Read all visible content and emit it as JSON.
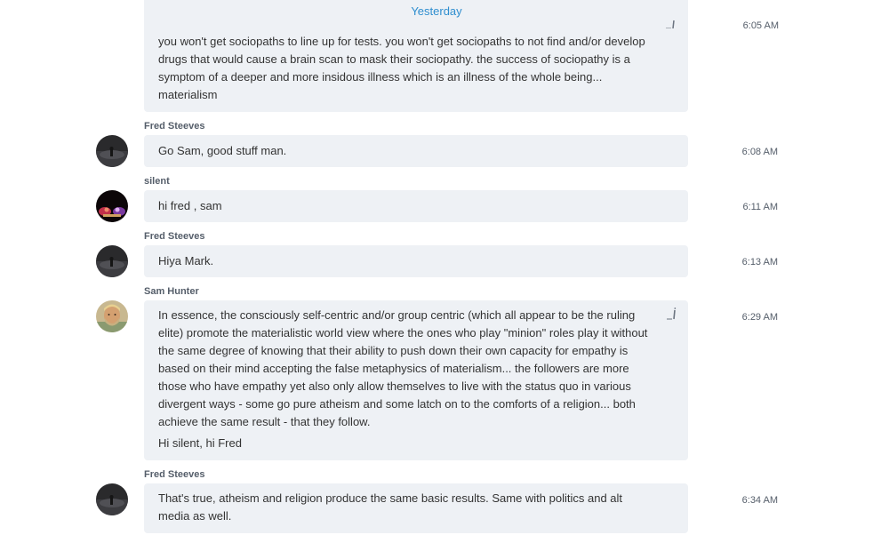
{
  "day_separator": "Yesterday",
  "messages": [
    {
      "sender": "",
      "time": "6:05 AM",
      "paragraphs": [
        "you won't get sociopaths to line up for tests.  you won't get sociopaths to not find and/or develop drugs that would cause a brain scan to mask their sociopathy.  the success of sociopathy is a symptom of a deeper and more insidous illness which is an illness of the whole being... materialism"
      ]
    },
    {
      "sender": "Fred Steeves",
      "time": "6:08 AM",
      "paragraphs": [
        "Go Sam, good stuff man."
      ]
    },
    {
      "sender": "silent",
      "time": "6:11 AM",
      "paragraphs": [
        "hi fred , sam"
      ]
    },
    {
      "sender": "Fred Steeves",
      "time": "6:13 AM",
      "paragraphs": [
        "Hiya Mark."
      ]
    },
    {
      "sender": "Sam Hunter",
      "time": "6:29 AM",
      "paragraphs": [
        "In essence, the consciously self-centric and/or group centric (which all appear to be the ruling elite) promote the materialistic world view where the ones who play \"minion\" roles play it without the same degree of knowing that their ability to push down their own capacity for empathy is based on their mind accepting the false metaphysics of materialism...   the followers are more those who have empathy yet also only allow themselves to live with the status quo in various divergent ways - some go pure atheism and some latch on to the comforts of a religion... both achieve the same result - that they follow.",
        "Hi silent, hi Fred"
      ]
    },
    {
      "sender": "Fred Steeves",
      "time": "6:34 AM",
      "paragraphs": [
        "That's true, atheism and religion produce the same basic results. Same with politics and alt media as well."
      ]
    }
  ],
  "icons": {
    "edited": "edit-pencil-icon",
    "avatar_fred": "fred-steeves-avatar",
    "avatar_silent": "silent-avatar",
    "avatar_sam": "sam-hunter-avatar"
  },
  "colors": {
    "bubble": "#eef1f5",
    "accent": "#2f8ecf",
    "meta_text": "#555e6a"
  }
}
